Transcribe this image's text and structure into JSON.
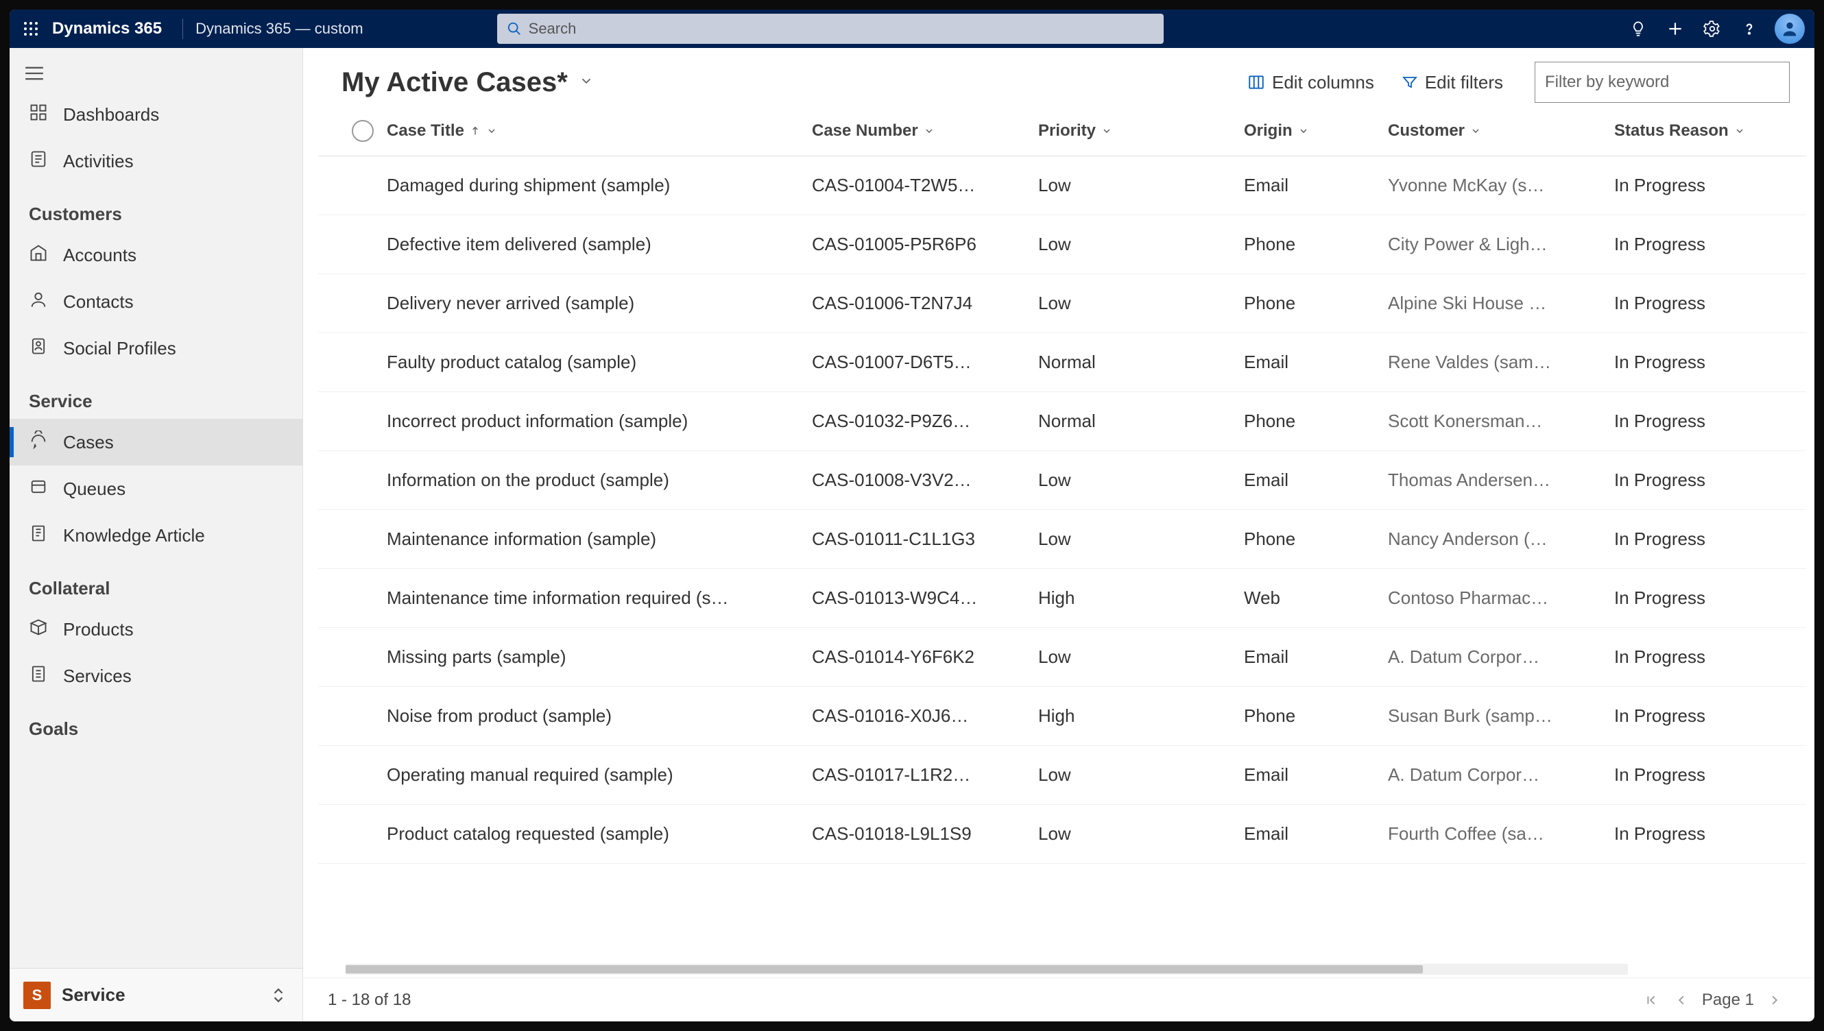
{
  "topbar": {
    "app_name": "Dynamics 365",
    "env_name": "Dynamics 365 — custom",
    "search_placeholder": "Search"
  },
  "sidebar": {
    "top_items": [
      {
        "label": "Dashboards",
        "icon": "dashboard-icon"
      },
      {
        "label": "Activities",
        "icon": "activities-icon"
      }
    ],
    "groups": [
      {
        "title": "Customers",
        "items": [
          {
            "label": "Accounts",
            "icon": "accounts-icon"
          },
          {
            "label": "Contacts",
            "icon": "contacts-icon"
          },
          {
            "label": "Social Profiles",
            "icon": "social-icon"
          }
        ]
      },
      {
        "title": "Service",
        "items": [
          {
            "label": "Cases",
            "icon": "cases-icon",
            "active": true
          },
          {
            "label": "Queues",
            "icon": "queues-icon"
          },
          {
            "label": "Knowledge Article",
            "icon": "knowledge-icon"
          }
        ]
      },
      {
        "title": "Collateral",
        "items": [
          {
            "label": "Products",
            "icon": "products-icon"
          },
          {
            "label": "Services",
            "icon": "services-icon"
          }
        ]
      },
      {
        "title": "Goals",
        "items": []
      }
    ],
    "footer": {
      "badge": "S",
      "label": "Service"
    }
  },
  "main": {
    "view_title": "My Active Cases*",
    "edit_columns_label": "Edit columns",
    "edit_filters_label": "Edit filters",
    "filter_placeholder": "Filter by keyword",
    "columns": {
      "title": "Case Title",
      "number": "Case Number",
      "priority": "Priority",
      "origin": "Origin",
      "customer": "Customer",
      "status": "Status Reason"
    },
    "rows": [
      {
        "title": "Damaged during shipment (sample)",
        "number": "CAS-01004-T2W5…",
        "priority": "Low",
        "origin": "Email",
        "customer": "Yvonne McKay (s…",
        "status": "In Progress"
      },
      {
        "title": "Defective item delivered (sample)",
        "number": "CAS-01005-P5R6P6",
        "priority": "Low",
        "origin": "Phone",
        "customer": "City Power & Ligh…",
        "status": "In Progress"
      },
      {
        "title": "Delivery never arrived (sample)",
        "number": "CAS-01006-T2N7J4",
        "priority": "Low",
        "origin": "Phone",
        "customer": "Alpine Ski House …",
        "status": "In Progress"
      },
      {
        "title": "Faulty product catalog (sample)",
        "number": "CAS-01007-D6T5…",
        "priority": "Normal",
        "origin": "Email",
        "customer": "Rene Valdes (sam…",
        "status": "In Progress"
      },
      {
        "title": "Incorrect product information (sample)",
        "number": "CAS-01032-P9Z6…",
        "priority": "Normal",
        "origin": "Phone",
        "customer": "Scott Konersman…",
        "status": "In Progress"
      },
      {
        "title": "Information on the product (sample)",
        "number": "CAS-01008-V3V2…",
        "priority": "Low",
        "origin": "Email",
        "customer": "Thomas Andersen…",
        "status": "In Progress"
      },
      {
        "title": "Maintenance information (sample)",
        "number": "CAS-01011-C1L1G3",
        "priority": "Low",
        "origin": "Phone",
        "customer": "Nancy Anderson (…",
        "status": "In Progress"
      },
      {
        "title": "Maintenance time information required (s…",
        "number": "CAS-01013-W9C4…",
        "priority": "High",
        "origin": "Web",
        "customer": "Contoso Pharmac…",
        "status": "In Progress"
      },
      {
        "title": "Missing parts (sample)",
        "number": "CAS-01014-Y6F6K2",
        "priority": "Low",
        "origin": "Email",
        "customer": "A. Datum Corpor…",
        "status": "In Progress"
      },
      {
        "title": "Noise from product (sample)",
        "number": "CAS-01016-X0J6…",
        "priority": "High",
        "origin": "Phone",
        "customer": "Susan Burk (samp…",
        "status": "In Progress"
      },
      {
        "title": "Operating manual required (sample)",
        "number": "CAS-01017-L1R2…",
        "priority": "Low",
        "origin": "Email",
        "customer": "A. Datum Corpor…",
        "status": "In Progress"
      },
      {
        "title": "Product catalog requested (sample)",
        "number": "CAS-01018-L9L1S9",
        "priority": "Low",
        "origin": "Email",
        "customer": "Fourth Coffee (sa…",
        "status": "In Progress"
      }
    ],
    "footer": {
      "range": "1 - 18 of 18",
      "page_label": "Page 1"
    }
  }
}
